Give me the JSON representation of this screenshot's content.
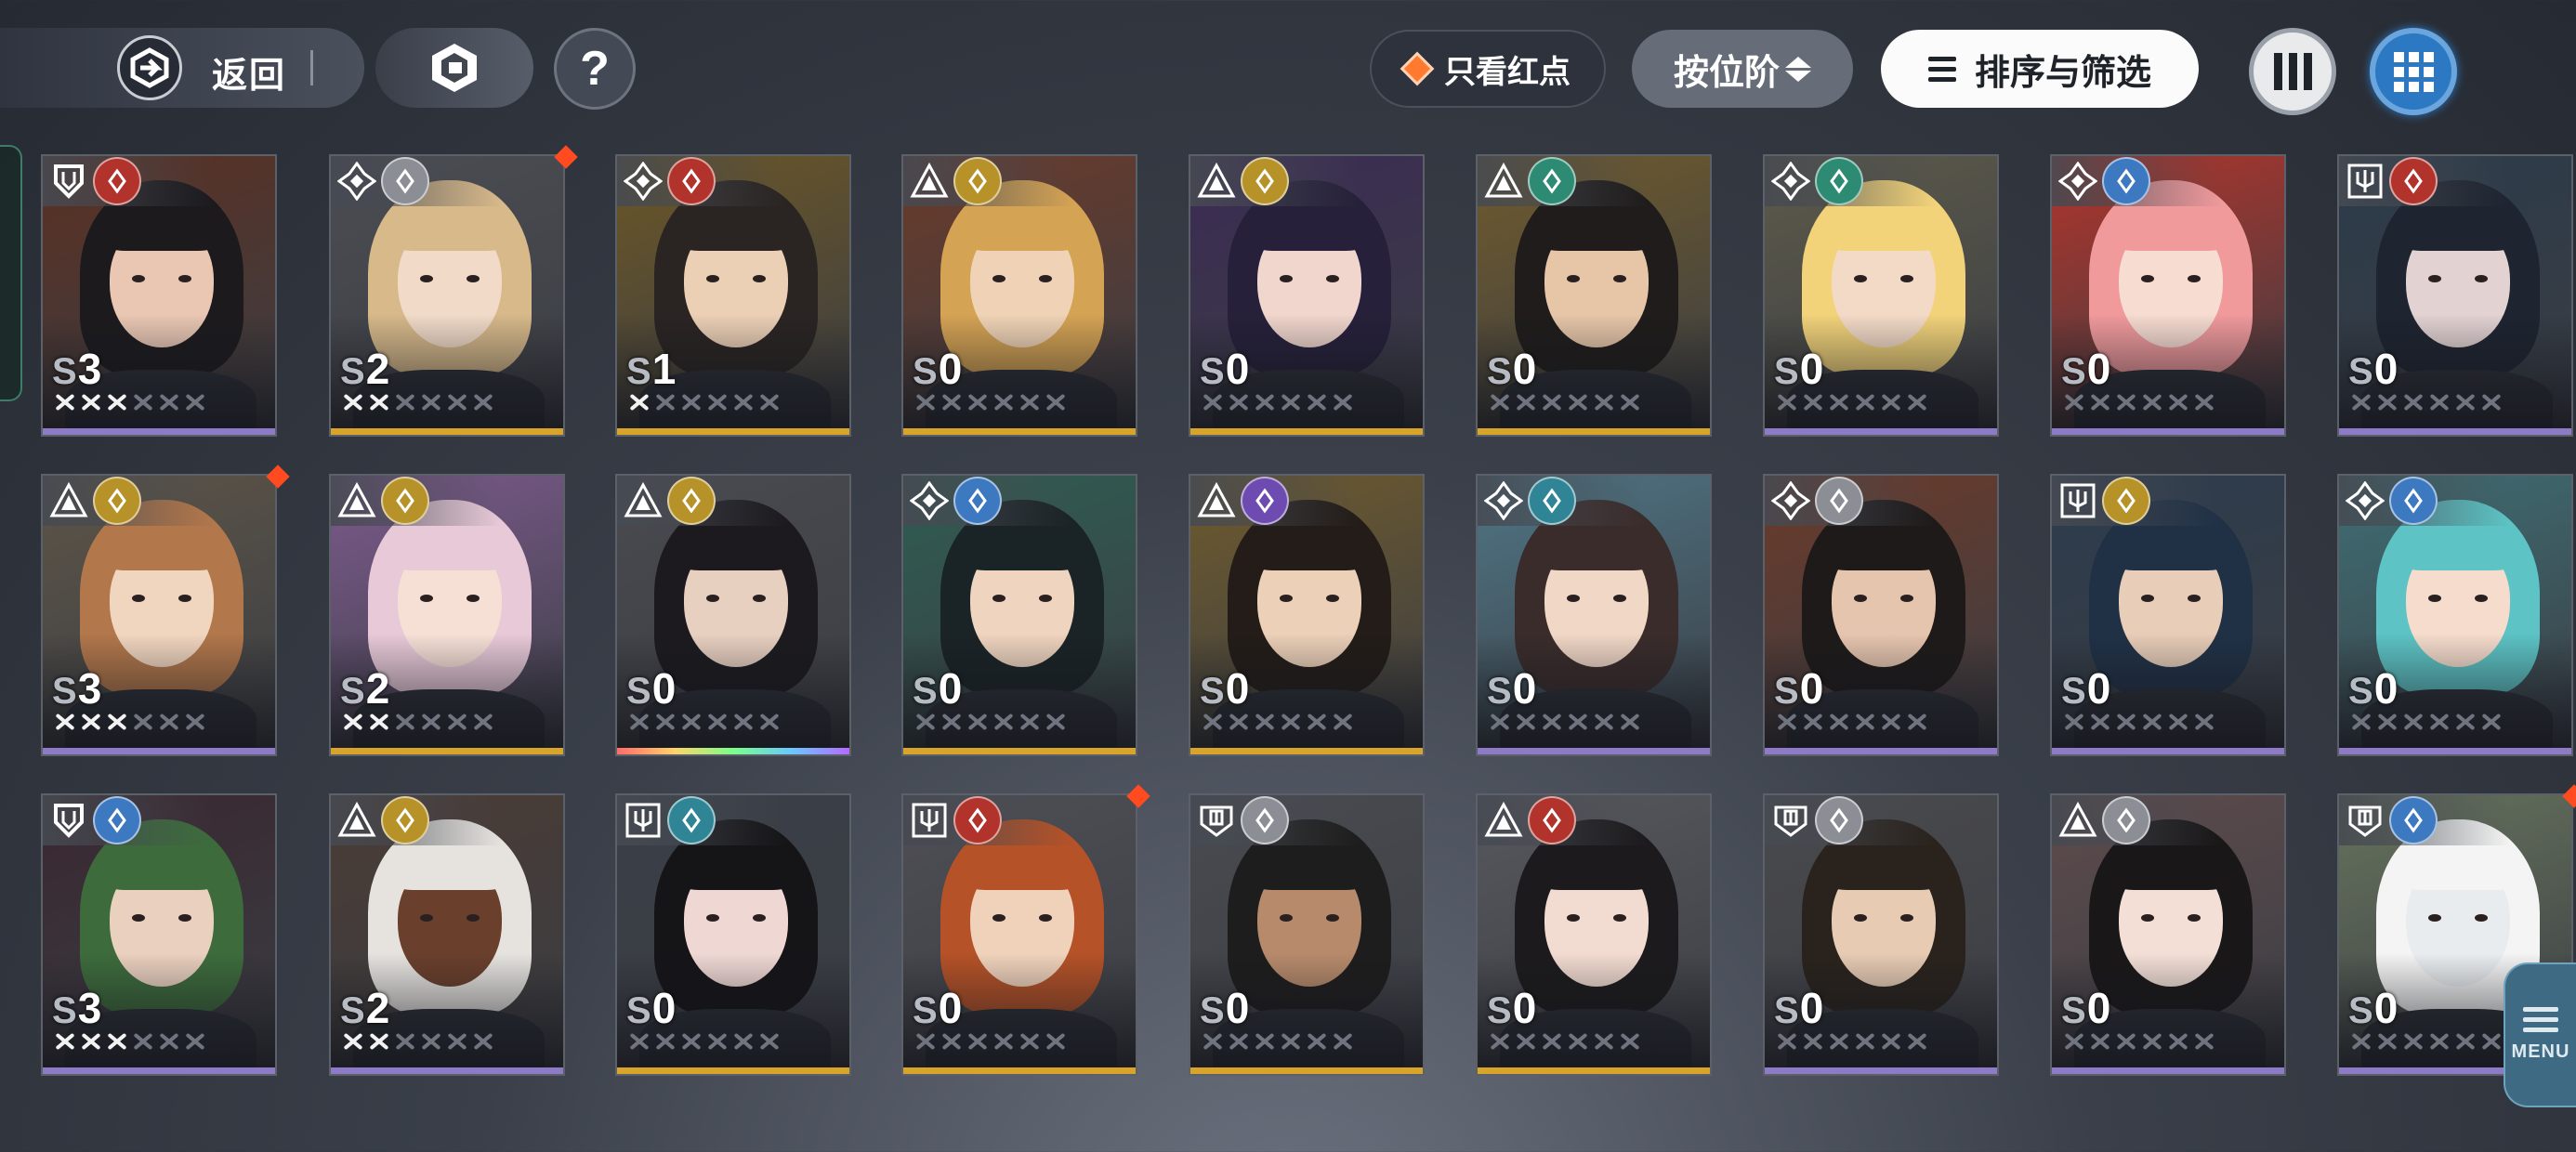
{
  "topbar": {
    "back_label": "返回",
    "red_only_label": "只看红点",
    "rank_sort_label": "按位阶",
    "sort_filter_label": "排序与筛选",
    "help_symbol": "?",
    "view_mode_selected": "grid"
  },
  "side": {
    "menu_label": "MENU"
  },
  "colors": {
    "gold_bar": "#d8a42a",
    "purple_bar": "#8d7bc8",
    "rainbow_bar": "linear",
    "fire": "#b2332b",
    "gold": "#b69228",
    "wind": "#2d8b73",
    "water": "#3d79c0",
    "ice": "#2f8596",
    "psy": "#6e4bb0",
    "grey": "#8b8e94"
  },
  "characters": [
    {
      "rank_prefix": "S",
      "rank": "3",
      "stars_on": 3,
      "class_icon": "shield-class-icon",
      "element": "fire",
      "bar": "purple",
      "red_dot": false,
      "hair": "#1c1a1d",
      "skin": "#e9c7b3",
      "bg": "#5a3022"
    },
    {
      "rank_prefix": "S",
      "rank": "2",
      "stars_on": 2,
      "class_icon": "crosshair-class-icon",
      "element": "grey",
      "bar": "gold",
      "red_dot": true,
      "hair": "#d7b98a",
      "skin": "#f1dac8",
      "bg": "#4b4d52"
    },
    {
      "rank_prefix": "S",
      "rank": "1",
      "stars_on": 1,
      "class_icon": "crosshair-class-icon",
      "element": "fire",
      "bar": "gold",
      "red_dot": false,
      "hair": "#2a2422",
      "skin": "#ecd0b6",
      "bg": "#6b5626"
    },
    {
      "rank_prefix": "S",
      "rank": "0",
      "stars_on": 0,
      "class_icon": "triangle-class-icon",
      "element": "gold",
      "bar": "gold",
      "red_dot": false,
      "hair": "#d5a354",
      "skin": "#f0d3b6",
      "bg": "#6a3a2a"
    },
    {
      "rank_prefix": "S",
      "rank": "0",
      "stars_on": 0,
      "class_icon": "triangle-class-icon",
      "element": "gold",
      "bar": "gold",
      "red_dot": false,
      "hair": "#26203a",
      "skin": "#f0d6cc",
      "bg": "#3b2b54"
    },
    {
      "rank_prefix": "S",
      "rank": "0",
      "stars_on": 0,
      "class_icon": "triangle-class-icon",
      "element": "wind",
      "bar": "gold",
      "red_dot": false,
      "hair": "#1f1c1b",
      "skin": "#e7c6a8",
      "bg": "#6f5a2c"
    },
    {
      "rank_prefix": "S",
      "rank": "0",
      "stars_on": 0,
      "class_icon": "crosshair-class-icon",
      "element": "wind",
      "bar": "purple",
      "red_dot": false,
      "hair": "#f2d37a",
      "skin": "#f3dac6",
      "bg": "#5d5a4a"
    },
    {
      "rank_prefix": "S",
      "rank": "0",
      "stars_on": 0,
      "class_icon": "crosshair-class-icon",
      "element": "water",
      "bar": "purple",
      "red_dot": false,
      "hair": "#f09a9c",
      "skin": "#f6dcd1",
      "bg": "#b0342b"
    },
    {
      "rank_prefix": "S",
      "rank": "0",
      "stars_on": 0,
      "class_icon": "trident-class-icon",
      "element": "fire",
      "bar": "purple",
      "red_dot": false,
      "hair": "#1e2430",
      "skin": "#e2d2d2",
      "bg": "#2b3a4a"
    },
    {
      "rank_prefix": "S",
      "rank": "3",
      "stars_on": 3,
      "class_icon": "triangle-class-icon",
      "element": "gold",
      "bar": "purple",
      "red_dot": true,
      "hair": "#b2774b",
      "skin": "#f1d6bf",
      "bg": "#5d5447"
    },
    {
      "rank_prefix": "S",
      "rank": "2",
      "stars_on": 2,
      "class_icon": "triangle-class-icon",
      "element": "gold",
      "bar": "gold",
      "red_dot": false,
      "hair": "#e8c9d8",
      "skin": "#f6e0d6",
      "bg": "#7c5a8c"
    },
    {
      "rank_prefix": "S",
      "rank": "0",
      "stars_on": 0,
      "class_icon": "triangle-class-icon",
      "element": "gold",
      "bar": "rainbow",
      "red_dot": false,
      "hair": "#1c1a1f",
      "skin": "#e8d0c0",
      "bg": "#4a4a4f"
    },
    {
      "rank_prefix": "S",
      "rank": "0",
      "stars_on": 0,
      "class_icon": "crosshair-class-icon",
      "element": "water",
      "bar": "gold",
      "red_dot": false,
      "hair": "#1a2326",
      "skin": "#efd4bf",
      "bg": "#2f5d52"
    },
    {
      "rank_prefix": "S",
      "rank": "0",
      "stars_on": 0,
      "class_icon": "triangle-class-icon",
      "element": "psy",
      "bar": "gold",
      "red_dot": false,
      "hair": "#231c18",
      "skin": "#ecd0b8",
      "bg": "#6e5a2d"
    },
    {
      "rank_prefix": "S",
      "rank": "0",
      "stars_on": 0,
      "class_icon": "crosshair-class-icon",
      "element": "ice",
      "bar": "purple",
      "red_dot": false,
      "hair": "#3a2c2b",
      "skin": "#f0d7c6",
      "bg": "#4f7585"
    },
    {
      "rank_prefix": "S",
      "rank": "0",
      "stars_on": 0,
      "class_icon": "crosshair-class-icon",
      "element": "grey",
      "bar": "purple",
      "red_dot": false,
      "hair": "#1e1a1a",
      "skin": "#e6c5ae",
      "bg": "#6b3a2a"
    },
    {
      "rank_prefix": "S",
      "rank": "0",
      "stars_on": 0,
      "class_icon": "trident-class-icon",
      "element": "gold",
      "bar": "purple",
      "red_dot": false,
      "hair": "#203146",
      "skin": "#e8cdb8",
      "bg": "#2c3b4d"
    },
    {
      "rank_prefix": "S",
      "rank": "0",
      "stars_on": 0,
      "class_icon": "crosshair-class-icon",
      "element": "water",
      "bar": "purple",
      "red_dot": false,
      "hair": "#5dc3c4",
      "skin": "#f5dccc",
      "bg": "#3e6e74"
    },
    {
      "rank_prefix": "S",
      "rank": "3",
      "stars_on": 3,
      "class_icon": "shield-class-icon",
      "element": "water",
      "bar": "purple",
      "red_dot": false,
      "hair": "#3d6b3c",
      "skin": "#ead0bf",
      "bg": "#3a2730"
    },
    {
      "rank_prefix": "S",
      "rank": "2",
      "stars_on": 2,
      "class_icon": "triangle-class-icon",
      "element": "gold",
      "bar": "purple",
      "red_dot": false,
      "hair": "#e6e3df",
      "skin": "#6a3f2c",
      "bg": "#4a3b34"
    },
    {
      "rank_prefix": "S",
      "rank": "0",
      "stars_on": 0,
      "class_icon": "trident-class-icon",
      "element": "ice",
      "bar": "gold",
      "red_dot": false,
      "hair": "#151417",
      "skin": "#efd8d4",
      "bg": "#3a3e46"
    },
    {
      "rank_prefix": "S",
      "rank": "0",
      "stars_on": 0,
      "class_icon": "trident-class-icon",
      "element": "fire",
      "bar": "gold",
      "red_dot": true,
      "hair": "#b55228",
      "skin": "#f0d2bb",
      "bg": "#4f4f55"
    },
    {
      "rank_prefix": "S",
      "rank": "0",
      "stars_on": 0,
      "class_icon": "helm-class-icon",
      "element": "grey",
      "bar": "gold",
      "red_dot": false,
      "hair": "#1e1d1d",
      "skin": "#b78a6b",
      "bg": "#494b50"
    },
    {
      "rank_prefix": "S",
      "rank": "0",
      "stars_on": 0,
      "class_icon": "triangle-class-icon",
      "element": "fire",
      "bar": "gold",
      "red_dot": false,
      "hair": "#1c1a1c",
      "skin": "#f2dbd0",
      "bg": "#57585d"
    },
    {
      "rank_prefix": "S",
      "rank": "0",
      "stars_on": 0,
      "class_icon": "helm-class-icon",
      "element": "grey",
      "bar": "purple",
      "red_dot": false,
      "hair": "#2a231d",
      "skin": "#e7cbb3",
      "bg": "#4a4a4d"
    },
    {
      "rank_prefix": "S",
      "rank": "0",
      "stars_on": 0,
      "class_icon": "triangle-class-icon",
      "element": "grey",
      "bar": "purple",
      "red_dot": false,
      "hair": "#1a1718",
      "skin": "#f3dfd6",
      "bg": "#5e4b4c"
    },
    {
      "rank_prefix": "S",
      "rank": "0",
      "stars_on": 0,
      "class_icon": "helm-class-icon",
      "element": "water",
      "bar": "purple",
      "red_dot": true,
      "hair": "#f4f4f4",
      "skin": "#e9ecef",
      "bg": "#66725c"
    }
  ]
}
